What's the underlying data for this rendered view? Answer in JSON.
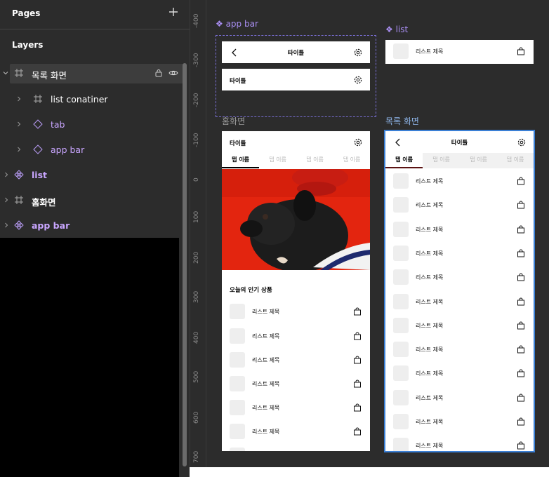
{
  "panel": {
    "pages_title": "Pages",
    "layers_title": "Layers",
    "layers": [
      {
        "label": "목록 화면",
        "type": "frame",
        "expanded": true,
        "selected": true
      },
      {
        "label": "list conatiner",
        "type": "frame"
      },
      {
        "label": "tab",
        "type": "component-instance"
      },
      {
        "label": "app bar",
        "type": "component-instance"
      },
      {
        "label": "list",
        "type": "component"
      },
      {
        "label": "홈화면",
        "type": "frame"
      },
      {
        "label": "app bar",
        "type": "component"
      }
    ]
  },
  "ruler": {
    "ticks": [
      "-400",
      "-300",
      "-200",
      "-100",
      "0",
      "100",
      "200",
      "300",
      "400",
      "500",
      "600",
      "700"
    ]
  },
  "canvas": {
    "appbar_component": {
      "label": "❖ app bar",
      "variant1_title": "타이틀",
      "variant2_title": "타이틀"
    },
    "list_component": {
      "label": "❖ list",
      "item_text": "리스트 제목"
    },
    "home": {
      "label": "홈화면",
      "title": "타이틀",
      "tabs": [
        "탭 이름",
        "탭 이름",
        "탭 이름",
        "탭 이름"
      ],
      "section_title": "오늘의 인기 상품",
      "items": [
        "리스트 제목",
        "리스트 제목",
        "리스트 제목",
        "리스트 제목",
        "리스트 제목",
        "리스트 제목"
      ]
    },
    "list_screen": {
      "label": "목록 화면",
      "title": "타이틀",
      "tabs": [
        "탭 이름",
        "탭 이름",
        "탭 이름",
        "탭 이름"
      ],
      "items": [
        "리스트 제목",
        "리스트 제목",
        "리스트 제목",
        "리스트 제목",
        "리스트 제목",
        "리스트 제목",
        "리스트 제목",
        "리스트 제목",
        "리스트 제목",
        "리스트 제목",
        "리스트 제목",
        "리스트 제목"
      ]
    }
  },
  "colors": {
    "panel_bg": "#2c2c2c",
    "component_purple": "#a98ef2",
    "selection_blue": "#3a7fd5"
  }
}
